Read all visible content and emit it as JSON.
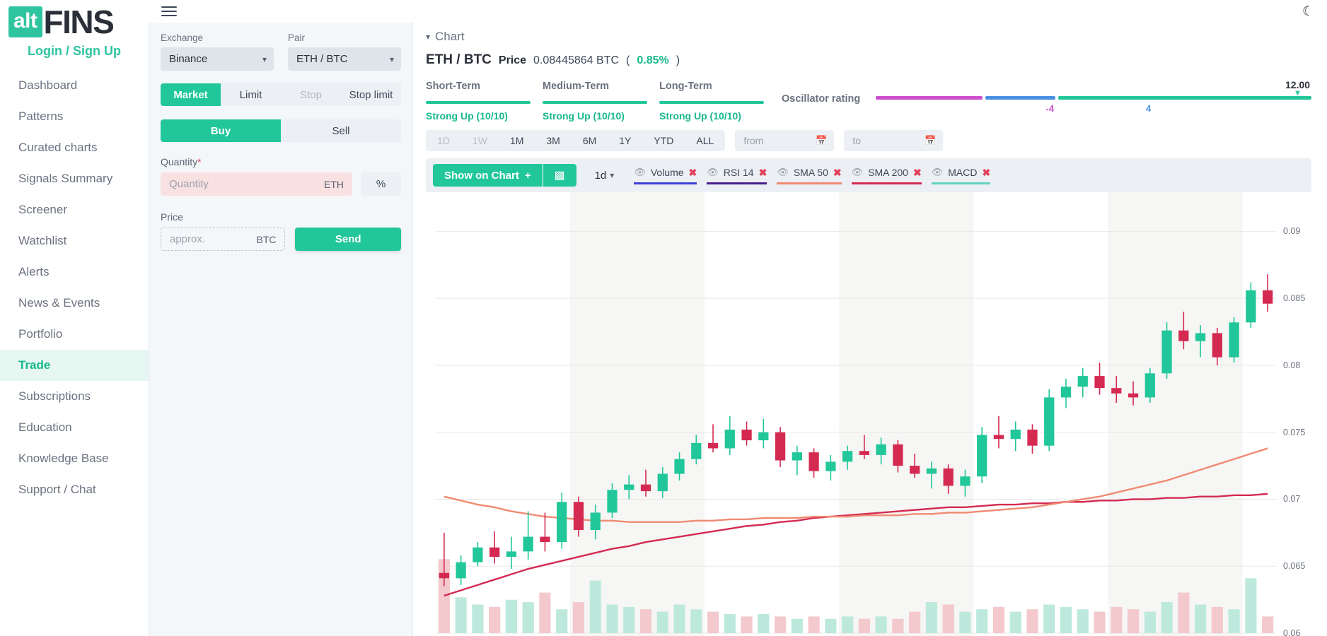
{
  "brand": {
    "alt": "alt",
    "fins": "FINS"
  },
  "auth": {
    "login_label": "Login / Sign Up"
  },
  "sidebar": {
    "items": [
      {
        "label": "Dashboard",
        "active": false
      },
      {
        "label": "Patterns",
        "active": false
      },
      {
        "label": "Curated charts",
        "active": false
      },
      {
        "label": "Signals Summary",
        "active": false
      },
      {
        "label": "Screener",
        "active": false
      },
      {
        "label": "Watchlist",
        "active": false
      },
      {
        "label": "Alerts",
        "active": false
      },
      {
        "label": "News & Events",
        "active": false
      },
      {
        "label": "Portfolio",
        "active": false
      },
      {
        "label": "Trade",
        "active": true
      },
      {
        "label": "Subscriptions",
        "active": false
      },
      {
        "label": "Education",
        "active": false
      },
      {
        "label": "Knowledge Base",
        "active": false
      },
      {
        "label": "Support / Chat",
        "active": false
      }
    ]
  },
  "topbar": {
    "menu_icon": "hamburger-icon",
    "theme_icon": "moon-icon"
  },
  "trade": {
    "exchange": {
      "label": "Exchange",
      "value": "Binance"
    },
    "pair": {
      "label": "Pair",
      "value": "ETH / BTC"
    },
    "order_types": [
      {
        "label": "Market",
        "state": "active"
      },
      {
        "label": "Limit",
        "state": "normal"
      },
      {
        "label": "Stop",
        "state": "disabled"
      },
      {
        "label": "Stop limit",
        "state": "normal"
      }
    ],
    "side": [
      {
        "label": "Buy",
        "state": "active"
      },
      {
        "label": "Sell",
        "state": "normal"
      }
    ],
    "quantity": {
      "label": "Quantity",
      "required_mark": "*",
      "placeholder": "Quantity",
      "value": "",
      "unit": "ETH",
      "percent_button": "%"
    },
    "price": {
      "label": "Price",
      "placeholder": "approx.",
      "value": "",
      "unit": "BTC"
    },
    "send_label": "Send"
  },
  "chart_header": {
    "collapse_label": "Chart",
    "pair": "ETH / BTC",
    "price_label": "Price",
    "price_value": "0.08445864 BTC",
    "change_open": "(",
    "change": "0.85%",
    "change_close": ")"
  },
  "ratings": [
    {
      "title": "Short-Term",
      "value": "Strong Up (10/10)",
      "color": "#21c79a"
    },
    {
      "title": "Medium-Term",
      "value": "Strong Up (10/10)",
      "color": "#21c79a"
    },
    {
      "title": "Long-Term",
      "value": "Strong Up (10/10)",
      "color": "#21c79a"
    }
  ],
  "oscillator": {
    "label": "Oscillator rating",
    "value": "12.00",
    "marker_icon": "caret-down-icon",
    "ticks": [
      {
        "label": "-4",
        "color": "#cc4ecc"
      },
      {
        "label": "4",
        "color": "#4a90e2"
      }
    ],
    "segments": [
      {
        "color": "#cc4ecc"
      },
      {
        "color": "#4a90e2"
      },
      {
        "color": "#21c79a"
      }
    ]
  },
  "timeframes": {
    "options": [
      {
        "label": "1D",
        "state": "disabled"
      },
      {
        "label": "1W",
        "state": "disabled"
      },
      {
        "label": "1M",
        "state": "normal"
      },
      {
        "label": "3M",
        "state": "normal"
      },
      {
        "label": "6M",
        "state": "normal"
      },
      {
        "label": "1Y",
        "state": "normal"
      },
      {
        "label": "YTD",
        "state": "normal"
      },
      {
        "label": "ALL",
        "state": "normal"
      }
    ],
    "from": {
      "placeholder": "from",
      "value": "",
      "icon": "calendar-icon"
    },
    "to": {
      "placeholder": "to",
      "value": "",
      "icon": "calendar-icon"
    }
  },
  "indicator_bar": {
    "show_on_chart": "Show on Chart",
    "show_on_chart_plus": "+",
    "bars_icon": "bar-chart-icon",
    "interval": "1d",
    "interval_icon": "chevron-down-icon",
    "indicators": [
      {
        "name": "Volume",
        "color": "#3b3fd8",
        "remove": "✖"
      },
      {
        "name": "RSI 14",
        "color": "#4b1d8c",
        "remove": "✖"
      },
      {
        "name": "SMA 50",
        "color": "#f08a72",
        "remove": "✖"
      },
      {
        "name": "SMA 200",
        "color": "#d42a52",
        "remove": "✖"
      },
      {
        "name": "MACD",
        "color": "#63d2c0",
        "remove": "✖"
      }
    ]
  },
  "chart_data": {
    "type": "candlestick",
    "title": "ETH / BTC",
    "xlabel": "",
    "ylabel": "",
    "ylim": [
      0.06,
      0.0925
    ],
    "yticks": [
      "0.09",
      "0.085",
      "0.08",
      "0.075",
      "0.07",
      "0.065",
      "0.06"
    ],
    "grid": true,
    "legend": [
      "Volume",
      "RSI 14",
      "SMA 50",
      "SMA 200",
      "MACD"
    ],
    "up_color": "#21c79a",
    "down_color": "#d42a52",
    "sma50_color": "#f08a72",
    "sma200_color": "#d42a52",
    "candles": [
      {
        "o": 0.0645,
        "h": 0.0675,
        "l": 0.0635,
        "c": 0.0641
      },
      {
        "o": 0.0641,
        "h": 0.0658,
        "l": 0.0636,
        "c": 0.0653
      },
      {
        "o": 0.0653,
        "h": 0.0668,
        "l": 0.065,
        "c": 0.0664
      },
      {
        "o": 0.0664,
        "h": 0.0676,
        "l": 0.0652,
        "c": 0.0657
      },
      {
        "o": 0.0657,
        "h": 0.0672,
        "l": 0.0648,
        "c": 0.0661
      },
      {
        "o": 0.0661,
        "h": 0.0691,
        "l": 0.0655,
        "c": 0.0672
      },
      {
        "o": 0.0672,
        "h": 0.069,
        "l": 0.0661,
        "c": 0.0668
      },
      {
        "o": 0.0668,
        "h": 0.0705,
        "l": 0.0663,
        "c": 0.0698
      },
      {
        "o": 0.0698,
        "h": 0.0702,
        "l": 0.0672,
        "c": 0.0677
      },
      {
        "o": 0.0677,
        "h": 0.0696,
        "l": 0.067,
        "c": 0.069
      },
      {
        "o": 0.069,
        "h": 0.0712,
        "l": 0.0686,
        "c": 0.0707
      },
      {
        "o": 0.0707,
        "h": 0.0718,
        "l": 0.07,
        "c": 0.0711
      },
      {
        "o": 0.0711,
        "h": 0.0722,
        "l": 0.0702,
        "c": 0.0706
      },
      {
        "o": 0.0706,
        "h": 0.0724,
        "l": 0.0701,
        "c": 0.0719
      },
      {
        "o": 0.0719,
        "h": 0.0735,
        "l": 0.0714,
        "c": 0.073
      },
      {
        "o": 0.073,
        "h": 0.0748,
        "l": 0.0726,
        "c": 0.0742
      },
      {
        "o": 0.0742,
        "h": 0.0756,
        "l": 0.0735,
        "c": 0.0738
      },
      {
        "o": 0.0738,
        "h": 0.0762,
        "l": 0.0733,
        "c": 0.0752
      },
      {
        "o": 0.0752,
        "h": 0.0758,
        "l": 0.074,
        "c": 0.0744
      },
      {
        "o": 0.0744,
        "h": 0.076,
        "l": 0.0738,
        "c": 0.075
      },
      {
        "o": 0.075,
        "h": 0.0754,
        "l": 0.0724,
        "c": 0.0729
      },
      {
        "o": 0.0729,
        "h": 0.074,
        "l": 0.0718,
        "c": 0.0735
      },
      {
        "o": 0.0735,
        "h": 0.0738,
        "l": 0.0716,
        "c": 0.0721
      },
      {
        "o": 0.0721,
        "h": 0.0733,
        "l": 0.0714,
        "c": 0.0728
      },
      {
        "o": 0.0728,
        "h": 0.074,
        "l": 0.0722,
        "c": 0.0736
      },
      {
        "o": 0.0736,
        "h": 0.0748,
        "l": 0.073,
        "c": 0.0733
      },
      {
        "o": 0.0733,
        "h": 0.0746,
        "l": 0.0726,
        "c": 0.0741
      },
      {
        "o": 0.0741,
        "h": 0.0744,
        "l": 0.072,
        "c": 0.0725
      },
      {
        "o": 0.0725,
        "h": 0.0734,
        "l": 0.0716,
        "c": 0.0719
      },
      {
        "o": 0.0719,
        "h": 0.0728,
        "l": 0.0708,
        "c": 0.0723
      },
      {
        "o": 0.0723,
        "h": 0.0726,
        "l": 0.0704,
        "c": 0.071
      },
      {
        "o": 0.071,
        "h": 0.0722,
        "l": 0.0702,
        "c": 0.0717
      },
      {
        "o": 0.0717,
        "h": 0.0754,
        "l": 0.0712,
        "c": 0.0748
      },
      {
        "o": 0.0748,
        "h": 0.0762,
        "l": 0.0738,
        "c": 0.0745
      },
      {
        "o": 0.0745,
        "h": 0.0758,
        "l": 0.0736,
        "c": 0.0752
      },
      {
        "o": 0.0752,
        "h": 0.0756,
        "l": 0.0734,
        "c": 0.074
      },
      {
        "o": 0.074,
        "h": 0.0782,
        "l": 0.0736,
        "c": 0.0776
      },
      {
        "o": 0.0776,
        "h": 0.079,
        "l": 0.0768,
        "c": 0.0784
      },
      {
        "o": 0.0784,
        "h": 0.0798,
        "l": 0.0776,
        "c": 0.0792
      },
      {
        "o": 0.0792,
        "h": 0.0802,
        "l": 0.0778,
        "c": 0.0783
      },
      {
        "o": 0.0783,
        "h": 0.0792,
        "l": 0.0772,
        "c": 0.0779
      },
      {
        "o": 0.0779,
        "h": 0.0788,
        "l": 0.077,
        "c": 0.0776
      },
      {
        "o": 0.0776,
        "h": 0.0798,
        "l": 0.0772,
        "c": 0.0794
      },
      {
        "o": 0.0794,
        "h": 0.0832,
        "l": 0.079,
        "c": 0.0826
      },
      {
        "o": 0.0826,
        "h": 0.084,
        "l": 0.0812,
        "c": 0.0818
      },
      {
        "o": 0.0818,
        "h": 0.083,
        "l": 0.0806,
        "c": 0.0824
      },
      {
        "o": 0.0824,
        "h": 0.0828,
        "l": 0.08,
        "c": 0.0806
      },
      {
        "o": 0.0806,
        "h": 0.0836,
        "l": 0.0802,
        "c": 0.0832
      },
      {
        "o": 0.0832,
        "h": 0.0862,
        "l": 0.0828,
        "c": 0.0856
      },
      {
        "o": 0.0856,
        "h": 0.0868,
        "l": 0.084,
        "c": 0.0846
      }
    ],
    "sma50": [
      0.0702,
      0.0699,
      0.0696,
      0.0694,
      0.0691,
      0.0689,
      0.0687,
      0.0686,
      0.0685,
      0.0684,
      0.0684,
      0.0683,
      0.0683,
      0.0683,
      0.0683,
      0.0684,
      0.0684,
      0.0685,
      0.0685,
      0.0686,
      0.0686,
      0.0686,
      0.0687,
      0.0687,
      0.0687,
      0.0688,
      0.0688,
      0.0688,
      0.0689,
      0.0689,
      0.069,
      0.069,
      0.0691,
      0.0692,
      0.0693,
      0.0694,
      0.0696,
      0.0698,
      0.07,
      0.0702,
      0.0705,
      0.0708,
      0.0711,
      0.0714,
      0.0718,
      0.0722,
      0.0726,
      0.073,
      0.0734,
      0.0738
    ],
    "sma200": [
      0.0628,
      0.0632,
      0.0636,
      0.064,
      0.0644,
      0.0648,
      0.0651,
      0.0654,
      0.0657,
      0.066,
      0.0663,
      0.0665,
      0.0668,
      0.067,
      0.0672,
      0.0674,
      0.0676,
      0.0678,
      0.068,
      0.0681,
      0.0683,
      0.0684,
      0.0686,
      0.0687,
      0.0688,
      0.0689,
      0.069,
      0.0691,
      0.0692,
      0.0693,
      0.0694,
      0.0694,
      0.0695,
      0.0696,
      0.0696,
      0.0697,
      0.0697,
      0.0698,
      0.0698,
      0.0699,
      0.0699,
      0.07,
      0.07,
      0.0701,
      0.0701,
      0.0702,
      0.0702,
      0.0703,
      0.0703,
      0.0704
    ],
    "volume": [
      62,
      30,
      24,
      22,
      28,
      26,
      34,
      20,
      26,
      44,
      24,
      22,
      20,
      18,
      24,
      20,
      18,
      16,
      14,
      16,
      14,
      12,
      14,
      12,
      14,
      12,
      14,
      12,
      18,
      26,
      24,
      18,
      20,
      22,
      18,
      20,
      24,
      22,
      20,
      18,
      22,
      20,
      18,
      26,
      34,
      24,
      22,
      20,
      46,
      14
    ]
  }
}
